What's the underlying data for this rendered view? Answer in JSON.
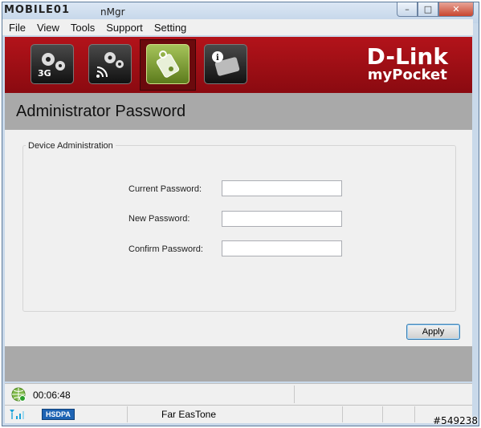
{
  "titlebar": {
    "logo": "MOBILE01",
    "app_title_fragment": "nMgr",
    "buttons": {
      "minimize": "–",
      "maximize": "□",
      "close": "✕"
    }
  },
  "menu": [
    "File",
    "View",
    "Tools",
    "Support",
    "Setting"
  ],
  "toolbar": {
    "icons": [
      "3g-settings-icon",
      "wireless-settings-icon",
      "password-icon",
      "device-info-icon"
    ],
    "tool1_text": "3G",
    "active_index": 2
  },
  "brand": {
    "name": "D-Link",
    "product": "myPocket"
  },
  "page": {
    "title": "Administrator Password"
  },
  "form": {
    "group_label": "Device Administration",
    "fields": [
      {
        "label": "Current Password:",
        "value": ""
      },
      {
        "label": "New Password:",
        "value": ""
      },
      {
        "label": "Confirm Password:",
        "value": ""
      }
    ],
    "apply_label": "Apply"
  },
  "status": {
    "connection_time": "00:06:48",
    "network_type": "HSDPA",
    "carrier": "Far EasTone"
  },
  "watermark": "#549238",
  "colors": {
    "banner": "#a4111a",
    "active_tool": "#8aab3b",
    "badge": "#1e64b4"
  }
}
